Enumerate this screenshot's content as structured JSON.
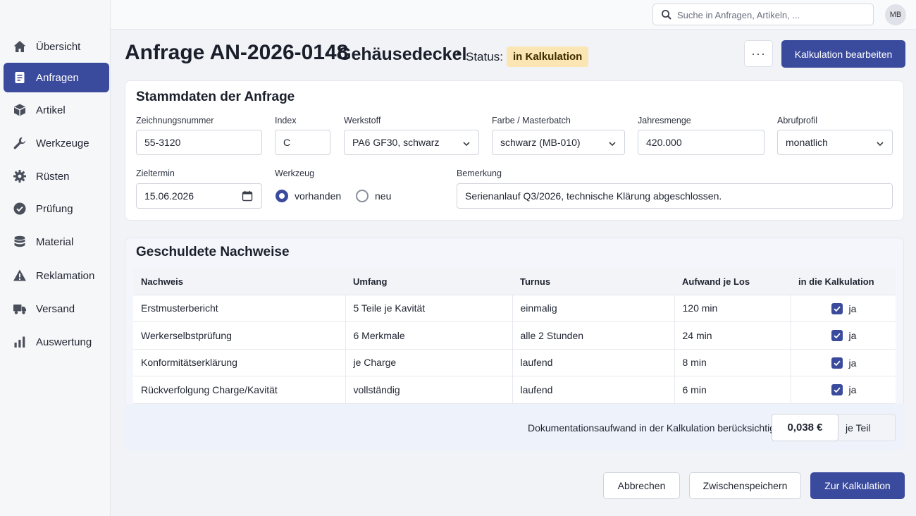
{
  "sidebar": {
    "items": [
      {
        "label": "Übersicht",
        "icon": "home-icon"
      },
      {
        "label": "Anfragen",
        "icon": "document-icon",
        "active": true
      },
      {
        "label": "Artikel",
        "icon": "cube-icon"
      },
      {
        "label": "Werkzeuge",
        "icon": "wrench-icon"
      },
      {
        "label": "Rüsten",
        "icon": "gear-icon"
      },
      {
        "label": "Prüfung",
        "icon": "check-circle-icon"
      },
      {
        "label": "Material",
        "icon": "database-icon"
      },
      {
        "label": "Reklamation",
        "icon": "warning-icon"
      },
      {
        "label": "Versand",
        "icon": "truck-icon"
      },
      {
        "label": "Auswertung",
        "icon": "bar-chart-icon"
      }
    ]
  },
  "topbar": {
    "search_placeholder": "Suche in Anfragen, Artikeln, ...",
    "avatar_initials": "MB"
  },
  "header": {
    "title": "Anfrage AN-2026-0148",
    "separator": "·",
    "subtitle": "Gehäusedeckel",
    "status_label": "Status:",
    "status_value": "in Kalkulation",
    "more_label": "···",
    "edit_button": "Kalkulation bearbeiten"
  },
  "stammdaten": {
    "title": "Stammdaten der Anfrage",
    "zeichnungsnummer": {
      "label": "Zeichnungsnummer",
      "value": "55-3120"
    },
    "index": {
      "label": "Index",
      "value": "C"
    },
    "werkstoff": {
      "label": "Werkstoff",
      "value": "PA6 GF30, schwarz"
    },
    "farbe": {
      "label": "Farbe / Masterbatch",
      "value": "schwarz (MB-010)"
    },
    "jahresmenge": {
      "label": "Jahresmenge",
      "value": "420.000"
    },
    "abrufprofil": {
      "label": "Abrufprofil",
      "value": "monatlich"
    },
    "zieltermin": {
      "label": "Zieltermin",
      "value": "15.06.2026"
    },
    "werkzeug": {
      "label": "Werkzeug",
      "option_1": "vorhanden",
      "option_2": "neu",
      "selected": "vorhanden"
    },
    "bemerkung": {
      "label": "Bemerkung",
      "value": "Serienanlauf Q3/2026, technische Klärung abgeschlossen."
    }
  },
  "nachweise": {
    "title": "Geschuldete Nachweise",
    "columns": [
      "Nachweis",
      "Umfang",
      "Turnus",
      "Aufwand je Los",
      "in die Kalkulation"
    ],
    "rows": [
      {
        "nachweis": "Erstmusterbericht",
        "umfang": "5 Teile je Kavität",
        "turnus": "einmalig",
        "aufwand": "120 min",
        "kalkulation": "ja",
        "checked": true
      },
      {
        "nachweis": "Werkerselbstprüfung",
        "umfang": "6 Merkmale",
        "turnus": "alle 2 Stunden",
        "aufwand": "24 min",
        "kalkulation": "ja",
        "checked": true
      },
      {
        "nachweis": "Konformitätserklärung",
        "umfang": "je Charge",
        "turnus": "laufend",
        "aufwand": "8 min",
        "kalkulation": "ja",
        "checked": true
      },
      {
        "nachweis": "Rückverfolgung Charge/Kavität",
        "umfang": "vollständig",
        "turnus": "laufend",
        "aufwand": "6 min",
        "kalkulation": "ja",
        "checked": true
      }
    ],
    "summary_label": "Dokumentationsaufwand in der Kalkulation berücksichtigt:",
    "summary_value": "0,038 €",
    "summary_unit": "je Teil"
  },
  "footer": {
    "cancel": "Abbrechen",
    "save_draft": "Zwischenspeichern",
    "to_calc": "Zur Kalkulation"
  },
  "colors": {
    "accent": "#3a4a9c",
    "status_badge_bg": "#fbe6b3"
  }
}
